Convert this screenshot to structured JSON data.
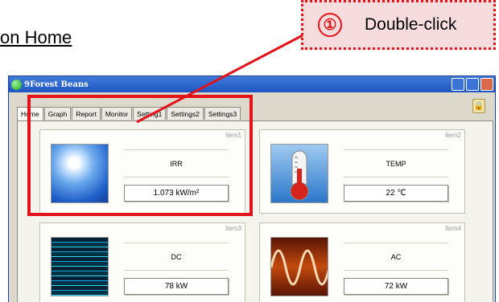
{
  "heading": "on Home",
  "callout": {
    "number": "①",
    "text": "Double-click"
  },
  "window": {
    "title": "9Forest Beans"
  },
  "tabs": [
    "Home",
    "Graph",
    "Report",
    "Monitor",
    "Setting1",
    "Settings2",
    "Settings3"
  ],
  "cards": [
    {
      "item": "Item1",
      "name": "IRR",
      "value": "1.073  kW/m²",
      "icon": "sun-image"
    },
    {
      "item": "Item2",
      "name": "TEMP",
      "value": "22 ℃",
      "icon": "thermometer-image"
    },
    {
      "item": "Item3",
      "name": "DC",
      "value": "78 kW",
      "icon": "light-lines-image"
    },
    {
      "item": "Item4",
      "name": "AC",
      "value": "72 kW",
      "icon": "sine-wave-image"
    }
  ],
  "colors": {
    "accent_red": "#e3131b",
    "callout_fill": "#f6dcdc",
    "titlebar_blue": "#1f55c4"
  }
}
